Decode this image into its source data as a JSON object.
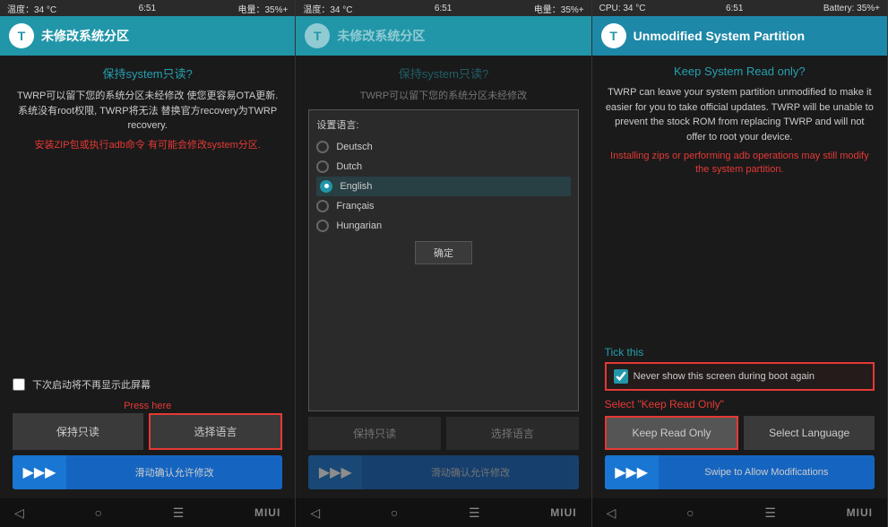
{
  "screen1": {
    "status": {
      "temp": "温度：34 °C",
      "time": "6:51",
      "battery": "电量：35%+"
    },
    "title": "未修改系统分区",
    "section_title": "保持system只读?",
    "main_text": "TWRP可以留下您的系统分区未经修改\n使您更容易OTA更新.\n系统没有root权限, TWRP将无法\n替换官方recovery为TWRP recovery.",
    "warning_text": "安装ZIP包或执行adb命令\n有可能会修改system分区.",
    "checkbox_label": "下次启动将不再显示此屏幕",
    "btn1": "保持只读",
    "btn2": "选择语言",
    "press_here": "Press here",
    "swipe_text": "滑动确认允许修改",
    "nav_back": "◁",
    "nav_home": "○",
    "nav_menu": "☰",
    "miui": "MIUI"
  },
  "screen2": {
    "status": {
      "temp": "温度：34 °C",
      "time": "6:51",
      "battery": "电量：35%+"
    },
    "title": "未修改系统分区",
    "section_title": "保持system只读?",
    "main_text": "TWRP可以留下您的系统分区未经修改",
    "lang_dialog": {
      "title": "设置语言:",
      "options": [
        "Deutsch",
        "Dutch",
        "English",
        "Français",
        "Hungarian"
      ],
      "selected": "English",
      "confirm_btn": "确定"
    },
    "btn1": "保持只读",
    "btn2": "选择语言",
    "swipe_text": "滑动确认允许修改",
    "nav_back": "◁",
    "nav_home": "○",
    "nav_menu": "☰",
    "miui": "MIUI"
  },
  "screen3": {
    "status": {
      "temp": "CPU: 34 °C",
      "time": "6:51",
      "battery": "Battery: 35%+"
    },
    "title": "Unmodified System Partition",
    "section_title": "Keep System Read only?",
    "main_text": "TWRP can leave your system partition unmodified to make it easier for you to take official updates. TWRP will be unable to prevent the stock ROM from replacing TWRP and will not offer to root your device.",
    "warning_text": "Installing zips or performing adb operations may still modify the system partition.",
    "tick_label": "Tick this",
    "never_show_text": "Never show this screen during boot again",
    "select_label": "Select \"Keep Read Only\"",
    "btn1": "Keep Read Only",
    "btn2": "Select Language",
    "swipe_text": "Swipe to Allow Modifications",
    "nav_back": "◁",
    "nav_home": "○",
    "nav_menu": "☰",
    "miui": "MIUI"
  }
}
